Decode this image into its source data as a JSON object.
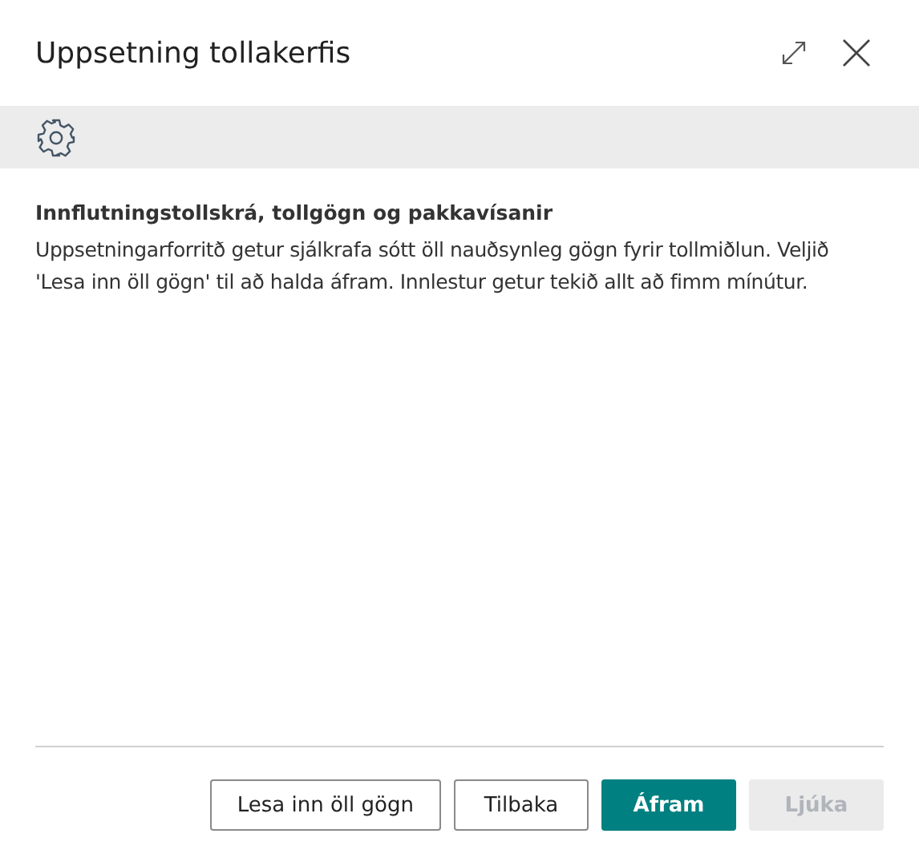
{
  "dialog": {
    "title": "Uppsetning tollakerfis"
  },
  "section": {
    "heading": "Innflutningstollskrá, tollgögn og pakkavísanir",
    "text": "Uppsetningarforritð getur sjálkrafa sótt öll nauðsynleg gögn fyrir tollmiðlun. Veljið 'Lesa inn öll gögn' til að halda áfram. Innlestur getur tekið allt að fimm mínútur."
  },
  "buttons": [
    {
      "label": "Lesa inn öll gögn",
      "kind": "default",
      "disabled": false
    },
    {
      "label": "Tilbaka",
      "kind": "default",
      "disabled": false
    },
    {
      "label": "Áfram",
      "kind": "primary",
      "disabled": false
    },
    {
      "label": "Ljúka",
      "kind": "default",
      "disabled": true
    }
  ]
}
